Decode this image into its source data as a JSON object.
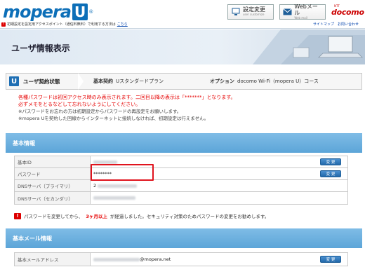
{
  "header": {
    "logo_text": "mopera",
    "logo_box": "U",
    "logo_reg": "®",
    "settings_btn": {
      "main": "設定変更",
      "sub": "user customize"
    },
    "webmail_btn": {
      "main": "Webメール",
      "sub": "Web mail"
    },
    "docomo": {
      "small": "NTT",
      "big": "docomo"
    },
    "info_text": "初期設定を設定用アクセスポイント（通信料無料）で利用する方法は",
    "info_link": "こちら",
    "links": [
      "サイトマップ",
      "お問い合わせ"
    ]
  },
  "banner": {
    "title": "ユーザ情報表示"
  },
  "status": {
    "label": "ユーザ契約状態",
    "plan_label": "基本契約",
    "plan_value": "Uスタンダードプラン",
    "option_label": "オプション",
    "option_value": "docomo Wi-Fi（mopera U）コース"
  },
  "notes": {
    "red1": "各種パスワードは初回アクセス時のみ表示されます。二回目以降の表示は「*******」となります。",
    "red2": "必ずメモをとるなどして忘れないようにしてください。",
    "gray1": "※パスワードをお忘れの方は初期設定からパスワードの再設定をお願いします。",
    "gray2": "※mopera Uを契約した回線からインターネットに接続しなければ、初期設定は行えません。"
  },
  "basic_section": {
    "title": "基本情報",
    "rows": [
      {
        "key": "基本ID",
        "value": "",
        "button": "変 更"
      },
      {
        "key": "パスワード",
        "value": "********",
        "button": "変 更"
      },
      {
        "key": "DNSサーバ（プライマリ）",
        "value": "2",
        "button": ""
      },
      {
        "key": "DNSサーバ（セカンダリ）",
        "value": "",
        "button": ""
      }
    ]
  },
  "warning": {
    "pre": "パスワードを変更してから、",
    "emph": "3ヶ月以上",
    "post": "が経過しました。セキュリティ対策のためパスワードの変更をお勧めします。"
  },
  "mail_section": {
    "title": "基本メール情報",
    "rows": [
      {
        "key": "基本メールアドレス",
        "value": "@mopera.net",
        "button": "変 更"
      }
    ]
  },
  "colors": {
    "brand": "#0d6fb8",
    "section": "#6fb2e0",
    "alert": "#e60000",
    "highlight": "#e0141e"
  }
}
